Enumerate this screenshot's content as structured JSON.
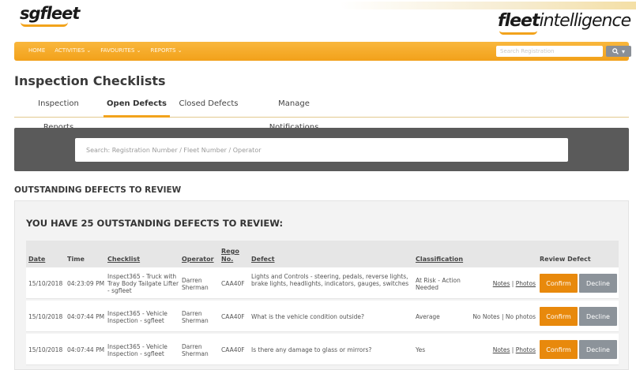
{
  "brand": {
    "sg_logo": "sgfleet",
    "fi_logo_bold": "fleet",
    "fi_logo_light": "intelligence"
  },
  "nav": {
    "items": [
      "HOME",
      "ACTIVITIES ⌄",
      "FAVOURITES ⌄",
      "REPORTS ⌄"
    ],
    "search_placeholder": "Search Registration",
    "search_icon": "search-icon",
    "caret": "▾"
  },
  "page": {
    "title": "Inspection Checklists"
  },
  "tabs": [
    {
      "label": "Inspection Reports",
      "active": false
    },
    {
      "label": "Open Defects",
      "active": true
    },
    {
      "label": "Closed Defects",
      "active": false
    },
    {
      "label": "Manage Notifications",
      "active": false
    }
  ],
  "search": {
    "placeholder": "Search: Registration Number / Fleet Number / Operator"
  },
  "section": {
    "heading": "OUTSTANDING DEFECTS TO REVIEW"
  },
  "panel": {
    "title": "YOU HAVE 25 OUTSTANDING DEFECTS TO REVIEW:"
  },
  "table": {
    "headers": {
      "date": "Date",
      "time": "Time",
      "checklist": "Checklist",
      "operator": "Operator",
      "rego": "Rego No.",
      "defect": "Defect",
      "classification": "Classification",
      "review": "Review Defect"
    },
    "rows": [
      {
        "date": "15/10/2018",
        "time": "04:23:09 PM",
        "checklist": "Inspect365 - Truck with Tray Body Tailgate Lifter - sgfleet",
        "operator": "Darren Sherman",
        "rego": "CAA40F",
        "defect": "Lights and Controls - steering, pedals, reverse lights, brake lights, headlights, indicators, gauges, switches",
        "classification": "At Risk - Action Needed",
        "notes": "Notes",
        "sep": "|",
        "photos": "Photos",
        "confirm": "Confirm",
        "decline": "Decline"
      },
      {
        "date": "15/10/2018",
        "time": "04:07:44 PM",
        "checklist": "Inspect365 - Vehicle Inspection - sgfleet",
        "operator": "Darren Sherman",
        "rego": "CAA40F",
        "defect": "What is the vehicle condition outside?",
        "classification": "Average",
        "notes": "No Notes",
        "sep": "|",
        "photos": "No photos",
        "confirm": "Confirm",
        "decline": "Decline"
      },
      {
        "date": "15/10/2018",
        "time": "04:07:44 PM",
        "checklist": "Inspect365 - Vehicle Inspection - sgfleet",
        "operator": "Darren Sherman",
        "rego": "CAA40F",
        "defect": "Is there any damage to glass or mirrors?",
        "classification": "Yes",
        "notes": "Notes",
        "sep": "|",
        "photos": "Photos",
        "confirm": "Confirm",
        "decline": "Decline"
      }
    ]
  }
}
